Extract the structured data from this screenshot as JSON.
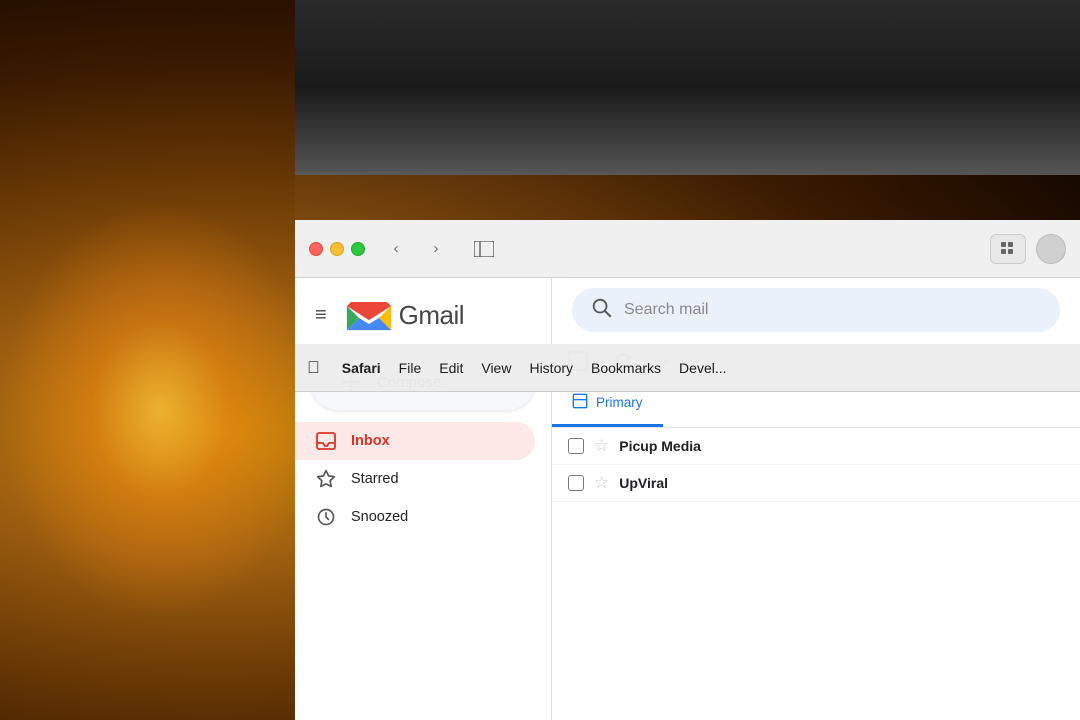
{
  "background": {
    "description": "warm bokeh background with orange light"
  },
  "menubar": {
    "apple_label": "",
    "safari_label": "Safari",
    "file_label": "File",
    "edit_label": "Edit",
    "view_label": "View",
    "history_label": "History",
    "bookmarks_label": "Bookmarks",
    "develop_label": "Devel..."
  },
  "browser": {
    "back_icon": "‹",
    "forward_icon": "›",
    "sidebar_icon": "⊡",
    "grid_icon": "⊞"
  },
  "gmail": {
    "hamburger_icon": "≡",
    "logo_text": "Gmail",
    "compose_label": "Compose",
    "search_placeholder": "Search mail",
    "sidebar_items": [
      {
        "id": "inbox",
        "label": "Inbox",
        "icon": "inbox",
        "active": true
      },
      {
        "id": "starred",
        "label": "Starred",
        "icon": "star"
      },
      {
        "id": "snoozed",
        "label": "Snoozed",
        "icon": "clock"
      }
    ],
    "tabs": [
      {
        "id": "primary",
        "label": "Primary",
        "icon": "inbox_tab"
      }
    ],
    "emails": [
      {
        "id": "1",
        "sender": "Picup Media",
        "starred": false
      },
      {
        "id": "2",
        "sender": "UpViral",
        "starred": false
      }
    ]
  }
}
